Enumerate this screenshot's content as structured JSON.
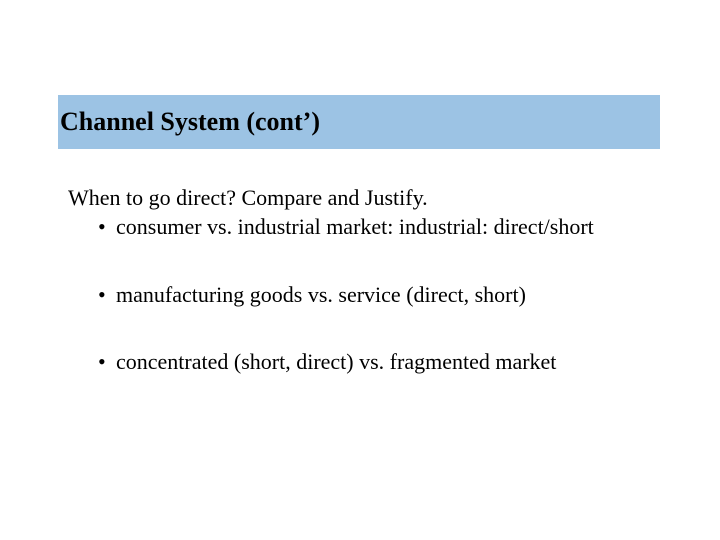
{
  "title": "Channel System (cont’)",
  "lead": "When to go direct? Compare and Justify.",
  "bullets": [
    "consumer vs. industrial market: industrial: direct/short",
    "manufacturing goods vs. service (direct, short)",
    "concentrated (short, direct) vs. fragmented market"
  ]
}
